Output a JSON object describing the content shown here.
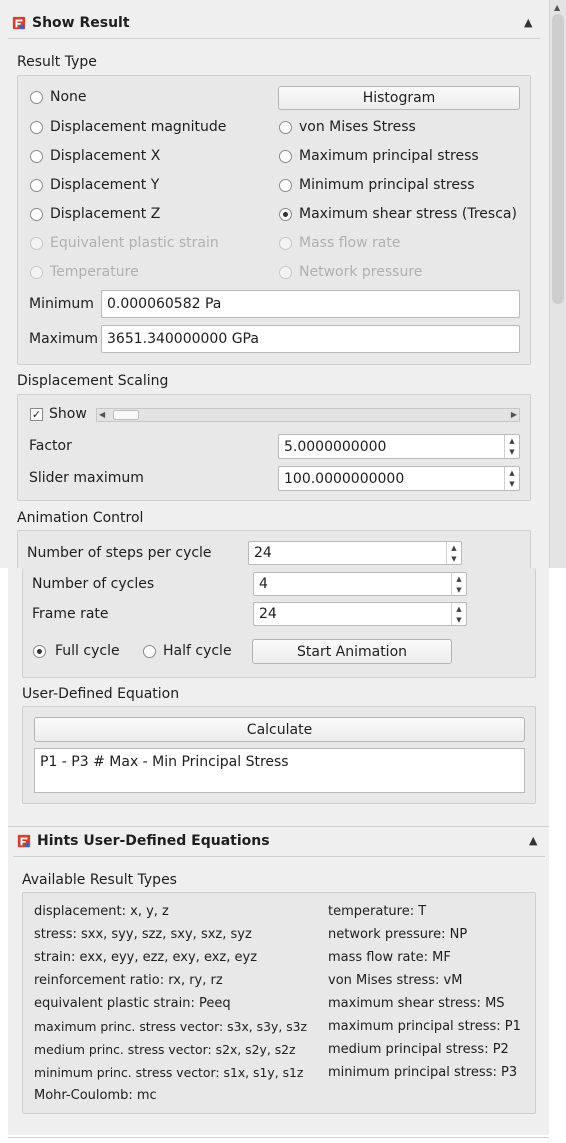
{
  "show_result": {
    "title": "Show Result",
    "result_type": {
      "label": "Result Type",
      "left_options": [
        {
          "label": "None",
          "checked": false,
          "enabled": true
        },
        {
          "label": "Displacement magnitude",
          "checked": false,
          "enabled": true
        },
        {
          "label": "Displacement X",
          "checked": false,
          "enabled": true
        },
        {
          "label": "Displacement Y",
          "checked": false,
          "enabled": true
        },
        {
          "label": "Displacement Z",
          "checked": false,
          "enabled": true
        },
        {
          "label": "Equivalent plastic strain",
          "checked": false,
          "enabled": false
        },
        {
          "label": "Temperature",
          "checked": false,
          "enabled": false
        }
      ],
      "histogram_button": "Histogram",
      "right_options": [
        {
          "label": "von Mises Stress",
          "checked": false,
          "enabled": true
        },
        {
          "label": "Maximum principal stress",
          "checked": false,
          "enabled": true
        },
        {
          "label": "Minimum principal stress",
          "checked": false,
          "enabled": true
        },
        {
          "label": "Maximum shear stress (Tresca)",
          "checked": true,
          "enabled": true
        },
        {
          "label": "Mass flow rate",
          "checked": false,
          "enabled": false
        },
        {
          "label": "Network pressure",
          "checked": false,
          "enabled": false
        }
      ],
      "minimum_label": "Minimum",
      "minimum_value": "0.000060582 Pa",
      "maximum_label": "Maximum",
      "maximum_value": "3651.340000000 GPa"
    },
    "displacement_scaling": {
      "label": "Displacement Scaling",
      "show_label": "Show",
      "show_checked": true,
      "factor_label": "Factor",
      "factor_value": "5.0000000000",
      "slider_max_label": "Slider maximum",
      "slider_max_value": "100.0000000000"
    },
    "animation_control": {
      "label": "Animation Control",
      "steps_label": "Number of steps per cycle",
      "steps_value": "24",
      "cycles_label": "Number of cycles",
      "cycles_value": "4",
      "frame_rate_label": "Frame rate",
      "frame_rate_value": "24",
      "full_cycle_label": "Full cycle",
      "half_cycle_label": "Half cycle",
      "selected": "full",
      "start_button": "Start Animation"
    },
    "user_equation": {
      "label": "User-Defined Equation",
      "calculate_button": "Calculate",
      "equation": "P1 - P3 # Max - Min Principal Stress"
    }
  },
  "hints": {
    "title": "Hints User-Defined Equations",
    "available_label": "Available Result Types",
    "left_items": [
      "displacement: x, y, z",
      "stress: sxx, syy, szz, sxy, sxz, syz",
      "strain: exx, eyy, ezz, exy, exz, eyz",
      "reinforcement ratio: rx, ry, rz",
      "equivalent plastic strain: Peeq",
      "maximum princ. stress vector: s3x, s3y, s3z",
      "medium princ. stress vector: s2x, s2y, s2z",
      "minimum princ. stress vector: s1x, s1y, s1z",
      "Mohr-Coulomb: mc"
    ],
    "right_items": [
      "temperature: T",
      "network pressure: NP",
      "mass flow rate: MF",
      "von Mises stress: vM",
      "maximum shear stress: MS",
      "maximum principal stress: P1",
      "medium principal stress: P2",
      "minimum principal stress: P3"
    ]
  },
  "icons": {
    "collapse": "chevron-up-icon",
    "logo": "freecad-fem-icon",
    "accent": "#e03a2e",
    "accent2": "#3a63c7"
  }
}
